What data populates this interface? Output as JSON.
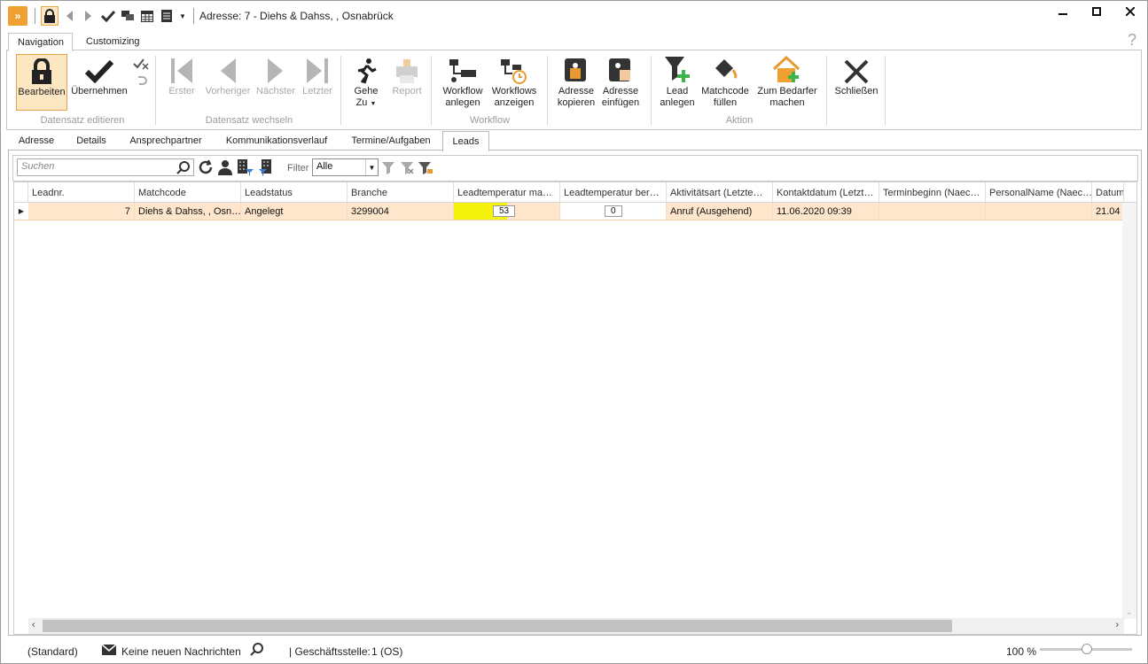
{
  "window": {
    "title": "Adresse: 7 - Diehs & Dahss, , Osnabrück",
    "app_icon": "app-logo-icon",
    "accent_color": "#f0a030"
  },
  "ribbon_tabs": [
    "Navigation",
    "Customizing"
  ],
  "ribbon": {
    "buttons": {
      "bearbeiten": "Bearbeiten",
      "uebernehmen": "Übernehmen",
      "erster": "Erster",
      "vorheriger": "Vorheriger",
      "naechster": "Nächster",
      "letzter": "Letzter",
      "gehe_zu_1": "Gehe",
      "gehe_zu_2": "Zu",
      "report": "Report",
      "workflow_anlegen_1": "Workflow",
      "workflow_anlegen_2": "anlegen",
      "workflows_anzeigen_1": "Workflows",
      "workflows_anzeigen_2": "anzeigen",
      "adresse_kopieren_1": "Adresse",
      "adresse_kopieren_2": "kopieren",
      "adresse_einfuegen_1": "Adresse",
      "adresse_einfuegen_2": "einfügen",
      "lead_anlegen_1": "Lead",
      "lead_anlegen_2": "anlegen",
      "matchcode_1": "Matchcode",
      "matchcode_2": "füllen",
      "bedarfer_1": "Zum Bedarfer",
      "bedarfer_2": "machen",
      "schliessen": "Schließen"
    },
    "groups": {
      "datensatz_editieren": "Datensatz editieren",
      "datensatz_wechseln": "Datensatz wechseln",
      "workflow": "Workflow",
      "aktion": "Aktion"
    }
  },
  "doc_tabs": [
    "Adresse",
    "Details",
    "Ansprechpartner",
    "Kommunikationsverlauf",
    "Termine/Aufgaben",
    "Leads"
  ],
  "search": {
    "placeholder": "Suchen",
    "filter_label": "Filter",
    "filter_value": "Alle"
  },
  "grid": {
    "columns": [
      "Leadnr.",
      "Matchcode",
      "Leadstatus",
      "Branche",
      "Leadtemperatur ma…",
      "Leadtemperatur ber…",
      "Aktivitätsart (Letzte…",
      "Kontaktdatum (Letzt…",
      "Terminbeginn (Naec…",
      "PersonalName (Naec…",
      "Datum"
    ],
    "rows": [
      {
        "leadnr": "7",
        "matchcode": "Diehs & Dahss, , Osn…",
        "leadstatus": "Angelegt",
        "branche": "3299004",
        "temp_ma": "53",
        "temp_ber": "0",
        "aktivitaet": "Anruf (Ausgehend)",
        "kontaktdatum": "11.06.2020 09:39",
        "terminbeginn": "",
        "personal": "",
        "datum": "21.04"
      }
    ]
  },
  "status": {
    "standard": "(Standard)",
    "messages": "Keine neuen Nachrichten",
    "branch_label": "| Geschäftsstelle:",
    "branch_value": "1 (OS)",
    "zoom": "100 %"
  }
}
